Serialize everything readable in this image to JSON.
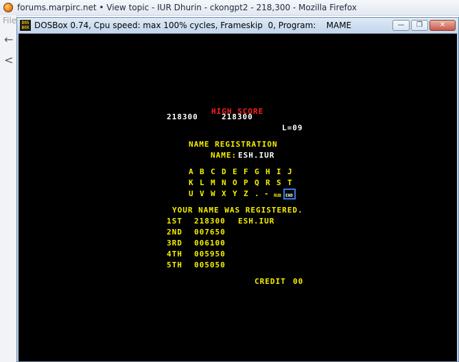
{
  "browser": {
    "title": "forums.marpirc.net • View topic - IUR Dhurin - ckongpt2 - 218,300 - Mozilla Firefox",
    "menu_stub": "File",
    "back_glyph": "←",
    "prev_glyph": "<"
  },
  "dosbox": {
    "icon_top": "DOS",
    "icon_bottom": "BOX",
    "title": "DOSBox 0.74, Cpu speed: max 100% cycles, Frameskip  0, Program:    MAME",
    "btn_minimize": "—",
    "btn_restore": "❐",
    "btn_close": "✕"
  },
  "game": {
    "high_score_label": "HIGH SCORE",
    "player_score": "218300",
    "high_score": "218300",
    "level": "L=09",
    "name_registration": "NAME REGISTRATION",
    "name_label": "NAME:",
    "name_value": "ESH.IUR",
    "letters_row1": [
      "A",
      "B",
      "C",
      "D",
      "E",
      "F",
      "G",
      "H",
      "I",
      "J"
    ],
    "letters_row2": [
      "K",
      "L",
      "M",
      "N",
      "O",
      "P",
      "Q",
      "R",
      "S",
      "T"
    ],
    "letters_row3": [
      "U",
      "V",
      "W",
      "X",
      "Y",
      "Z",
      ".",
      "-"
    ],
    "rub_label": "RUB",
    "end_label": "END",
    "registered_message": "YOUR NAME WAS REGISTERED.",
    "rankings": [
      {
        "rank": "1ST",
        "score": "218300",
        "name": "ESH.IUR"
      },
      {
        "rank": "2ND",
        "score": "007650",
        "name": ""
      },
      {
        "rank": "3RD",
        "score": "006100",
        "name": ""
      },
      {
        "rank": "4TH",
        "score": "005950",
        "name": ""
      },
      {
        "rank": "5TH",
        "score": "005050",
        "name": ""
      }
    ],
    "credit_label": "CREDIT",
    "credit_value": "00"
  }
}
